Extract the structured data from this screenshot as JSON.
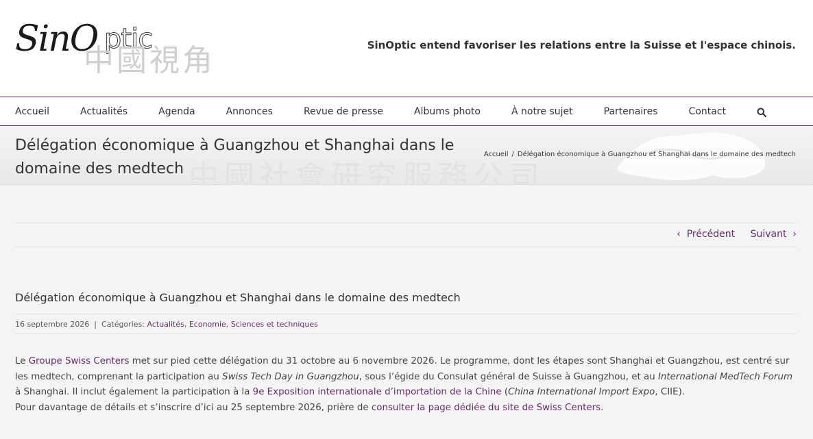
{
  "header": {
    "logo_main": "Sin",
    "logo_o": "O",
    "logo_ptic": "ptic",
    "logo_cjk": "中國視角",
    "tagline": "SinOptic entend favoriser les relations entre la Suisse et l'espace chinois."
  },
  "nav": {
    "items": [
      "Accueil",
      "Actualités",
      "Agenda",
      "Annonces",
      "Revue de presse",
      "Albums photo",
      "À notre sujet",
      "Partenaires",
      "Contact"
    ],
    "search_icon": "search-icon"
  },
  "titlebar": {
    "title": "Délégation économique à Guangzhou et Shanghai dans le domaine des medtech",
    "watermark": "中國社會研究服務公司",
    "breadcrumb_home": "Accueil",
    "breadcrumb_sep": "/",
    "breadcrumb_current": "Délégation économique à Guangzhou et Shanghai dans le domaine des medtech"
  },
  "postnav": {
    "prev_label": "Précédent",
    "next_label": "Suivant"
  },
  "post": {
    "title": "Délégation économique à Guangzhou et Shanghai dans le domaine des medtech",
    "date": "16 septembre 2026",
    "meta_sep": "|",
    "categories_label": "Catégories:",
    "categories": [
      "Actualités",
      "Economie",
      "Sciences et techniques"
    ],
    "p1_a": "Le ",
    "p1_link1": "Groupe Swiss Centers",
    "p1_b": " met sur pied cette délégation du 31 octobre au 6 novembre 2026. Le programme, dont les étapes sont Shanghai et Guangzhou, est centré sur les medtech, comprenant la participation au ",
    "p1_em1": "Swiss Tech Day in Guangzhou",
    "p1_c": ", sous l’égide du Consulat général de Suisse à Guangzhou, et au ",
    "p1_em2": "International MedTech Forum",
    "p1_d": " à Shanghai. Il inclut également la participation à la ",
    "p1_link2": "9e Exposition internationale d’importation de la Chine",
    "p1_e": " (",
    "p1_em3": "China International Import Expo",
    "p1_f": ", CIIE).",
    "p2_a": "Pour davantage de détails et s’inscrire d’ici au 25 septembre 2026, prière de ",
    "p2_link": "consulter la page dédiée du site de Swiss Centers",
    "p2_b": "."
  },
  "colors": {
    "accent": "#6b2a6b",
    "text": "#333333",
    "background": "#f4f4f4"
  }
}
